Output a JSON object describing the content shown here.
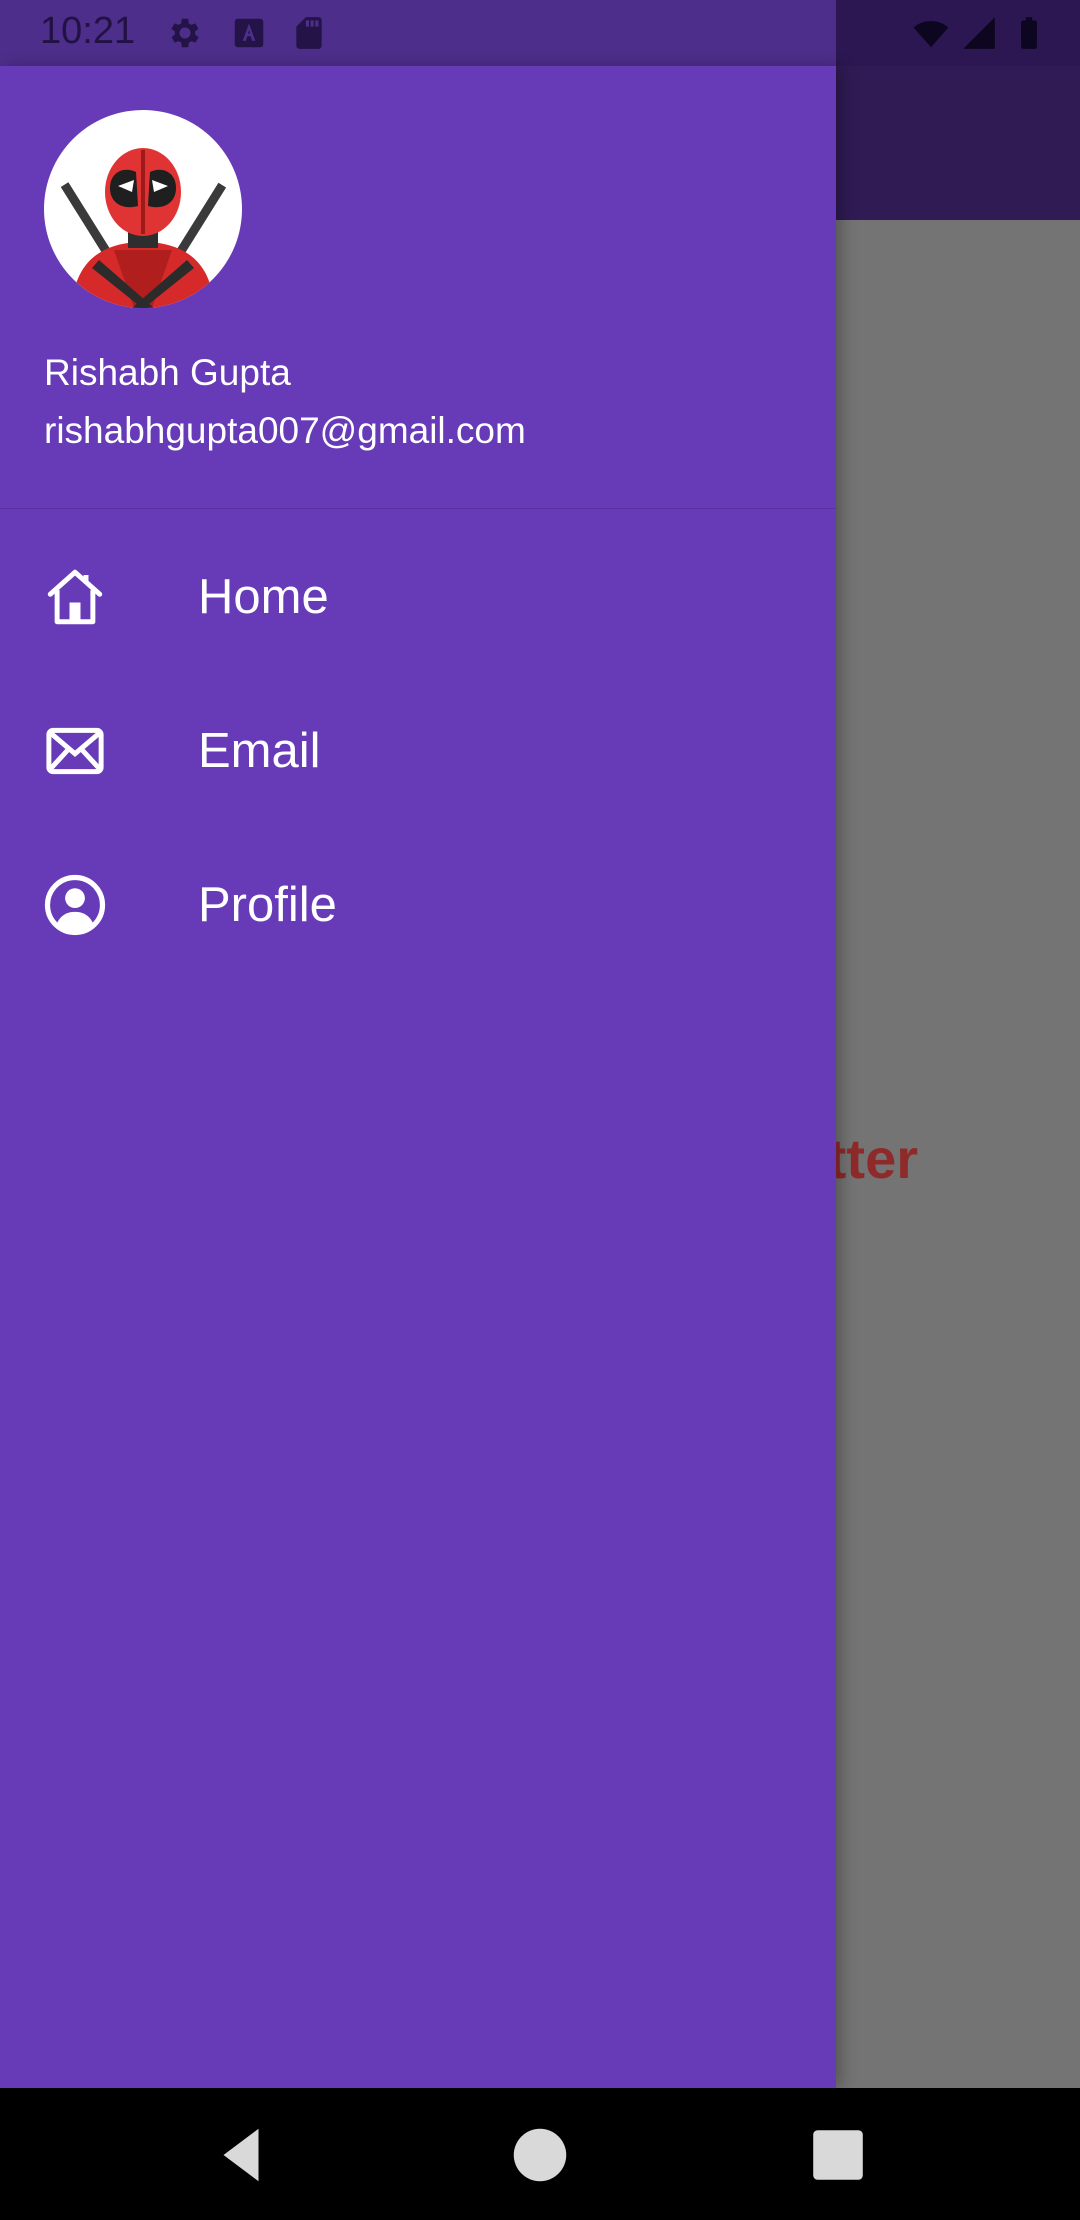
{
  "status_bar": {
    "time": "10:21",
    "left_icons": [
      "settings-icon",
      "font-a-icon",
      "sd-card-icon"
    ],
    "right_icons": [
      "wifi-icon",
      "signal-icon",
      "battery-icon"
    ]
  },
  "background": {
    "partial_text": "tter",
    "text_color": "#8f2a2a"
  },
  "drawer": {
    "background_color": "#673ab7",
    "header": {
      "avatar_icon": "deadpool-avatar-icon",
      "name": "Rishabh Gupta",
      "email": "rishabhgupta007@gmail.com"
    },
    "menu": [
      {
        "label": "Home",
        "icon": "home-icon"
      },
      {
        "label": "Email",
        "icon": "mail-icon"
      },
      {
        "label": "Profile",
        "icon": "account-circle-icon"
      }
    ]
  },
  "nav_bar": {
    "buttons": [
      "back-icon",
      "home-circle-icon",
      "recents-icon"
    ]
  }
}
